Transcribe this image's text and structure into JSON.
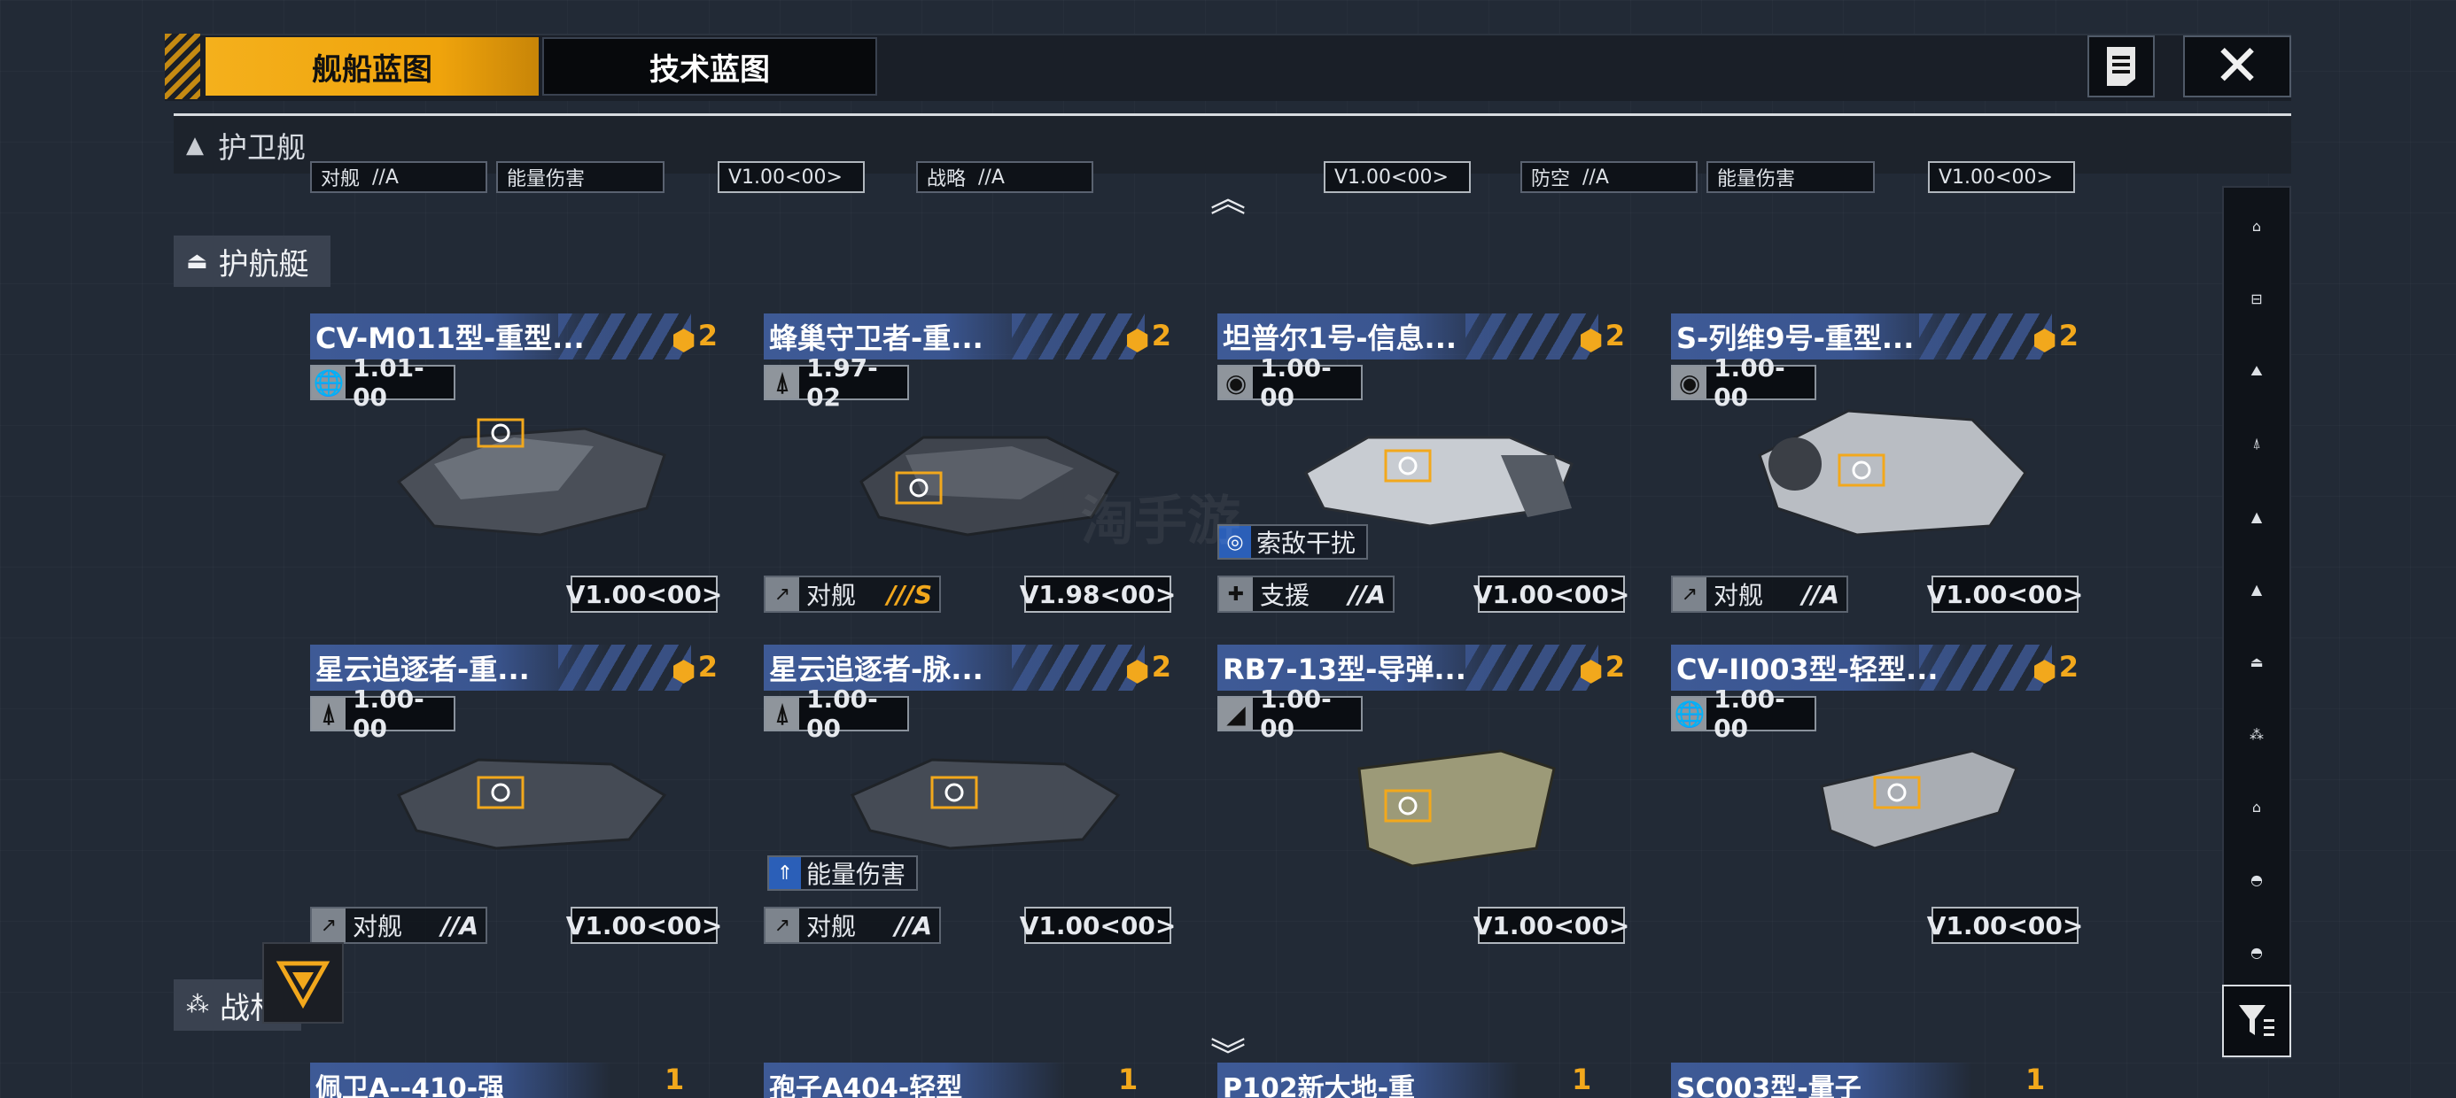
{
  "tabs": [
    {
      "label": "舰船蓝图",
      "active": true
    },
    {
      "label": "技术蓝图",
      "active": false
    }
  ],
  "header": {
    "category_label": "护卫舰"
  },
  "partial_top_row": [
    {
      "role": "对舰",
      "grade": "//A",
      "tag": "能量伤害",
      "version": "V1.00<00>"
    },
    {
      "role": "战略",
      "grade": "//A",
      "version": "V1.00<00>"
    },
    {
      "role": "防空",
      "grade": "//A",
      "tag": "能量伤害",
      "version": "V1.00<00>"
    }
  ],
  "sections": {
    "corvette": "护航艇",
    "next": "战材"
  },
  "cards": [
    {
      "title": "CV-M011型-重型...",
      "count": "2",
      "version_top": "1.01-00",
      "icon": "globe-icon",
      "role": "",
      "grade": "",
      "version_bottom": "V1.00<00>",
      "tags": []
    },
    {
      "title": "蜂巢守卫者-重...",
      "count": "2",
      "version_top": "1.97-02",
      "icon": "missile-icon",
      "role": "对舰",
      "grade": "///S",
      "version_bottom": "V1.98<00>",
      "tags": []
    },
    {
      "title": "坦普尔1号-信息...",
      "count": "2",
      "version_top": "1.00-00",
      "icon": "radar-icon",
      "role": "支援",
      "grade": "//A",
      "version_bottom": "V1.00<00>",
      "tags": [
        "索敌干扰"
      ]
    },
    {
      "title": "S-列维9号-重型...",
      "count": "2",
      "version_top": "1.00-00",
      "icon": "radar-icon",
      "role": "对舰",
      "grade": "//A",
      "version_bottom": "V1.00<00>",
      "tags": []
    },
    {
      "title": "星云追逐者-重...",
      "count": "2",
      "version_top": "1.00-00",
      "icon": "missile-icon",
      "role": "对舰",
      "grade": "//A",
      "version_bottom": "V1.00<00>",
      "tags": []
    },
    {
      "title": "星云追逐者-脉...",
      "count": "2",
      "version_top": "1.00-00",
      "icon": "missile-icon",
      "role": "对舰",
      "grade": "//A",
      "version_bottom": "V1.00<00>",
      "tags": [
        "能量伤害"
      ]
    },
    {
      "title": "RB7-13型-导弹...",
      "count": "2",
      "version_top": "1.00-00",
      "icon": "launcher-icon",
      "role": "",
      "grade": "",
      "version_bottom": "V1.00<00>",
      "tags": []
    },
    {
      "title": "CV-II003型-轻型...",
      "count": "2",
      "version_top": "1.00-00",
      "icon": "globe-icon",
      "role": "",
      "grade": "",
      "version_bottom": "V1.00<00>",
      "tags": []
    }
  ],
  "bottom_partial_cards": [
    {
      "title": "佩卫A--410-强",
      "count": "1"
    },
    {
      "title": "孢子A404-轻型",
      "count": "1"
    },
    {
      "title": "P102新大地-重",
      "count": "1"
    },
    {
      "title": "SC003型-量子",
      "count": "1"
    }
  ],
  "watermark": "淘手游"
}
